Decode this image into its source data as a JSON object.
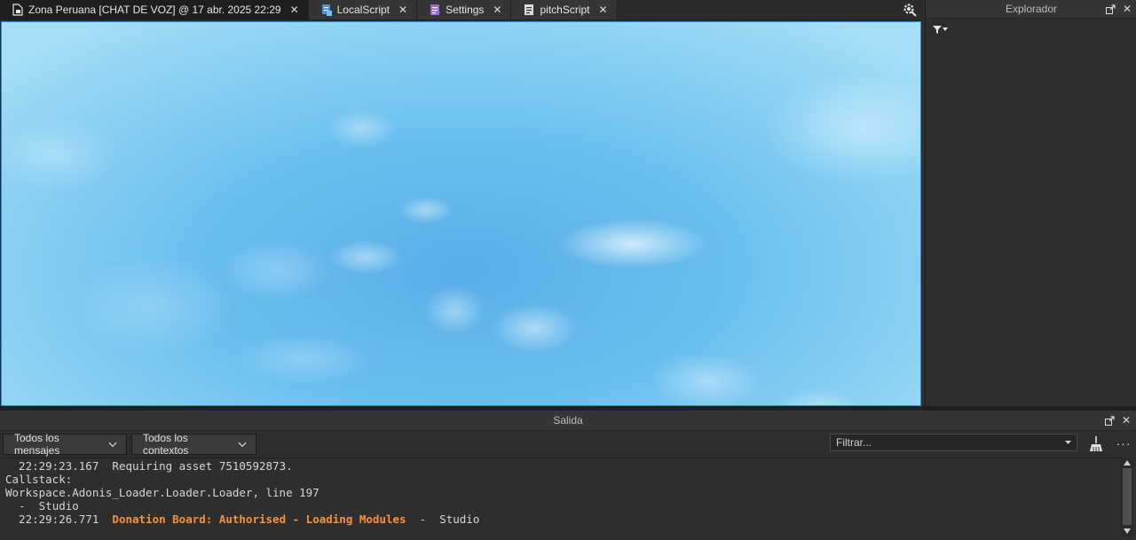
{
  "tabs": [
    {
      "label": "Zona Peruana [CHAT DE VOZ] @ 17 abr. 2025 22:29",
      "icon": "place-file-icon",
      "active": true
    },
    {
      "label": "LocalScript",
      "icon": "local-script-icon",
      "active": false
    },
    {
      "label": "Settings",
      "icon": "module-script-icon",
      "active": false
    },
    {
      "label": "pitchScript",
      "icon": "script-icon",
      "active": false
    }
  ],
  "close_glyph": "✕",
  "explorer": {
    "title": "Explorador"
  },
  "output": {
    "title": "Salida",
    "message_filter": "Todos los mensajes",
    "context_filter": "Todos los contextos",
    "filter_placeholder": "Filtrar...",
    "more_glyph": "···",
    "lines": [
      {
        "ts": "  22:29:23.167  ",
        "text": "Requiring asset 7510592873.",
        "warn": false
      },
      {
        "ts": "",
        "text": "Callstack:",
        "warn": false
      },
      {
        "ts": "",
        "text": "Workspace.Adonis_Loader.Loader.Loader, line 197",
        "warn": false
      },
      {
        "ts": "  -  ",
        "text": "Studio",
        "warn": false
      },
      {
        "ts": "  22:29:26.771  ",
        "text": "Donation Board: Authorised - Loading Modules",
        "warn": true,
        "suffix": "  -  Studio"
      }
    ]
  },
  "colors": {
    "accent": "#2f86d6",
    "warning": "#f6923c",
    "panel_bg": "#2e2e2e"
  }
}
